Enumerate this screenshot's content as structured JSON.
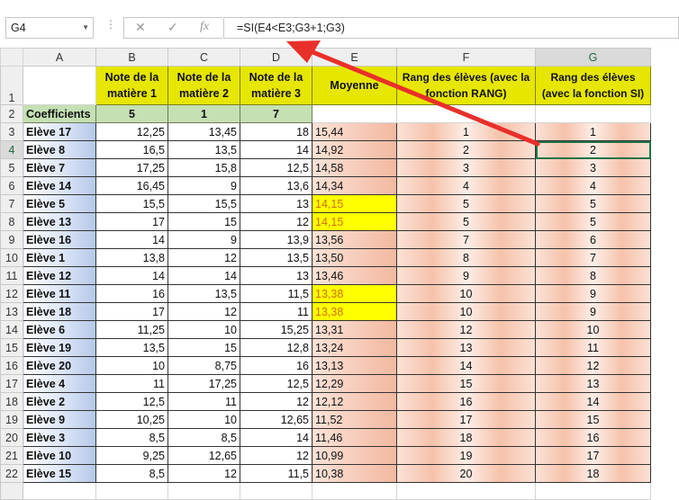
{
  "formula_bar": {
    "name_box": "G4",
    "cancel_icon": "✕",
    "enter_icon": "✓",
    "fx_label": "fx",
    "formula": "=SI(E4<E3;G3+1;G3)"
  },
  "columns": [
    "A",
    "B",
    "C",
    "D",
    "E",
    "F",
    "G"
  ],
  "header_row": {
    "row_num": "1",
    "b": "Note de la matière 1",
    "c": "Note de la matière 2",
    "d": "Note de la matière 3",
    "e": "Moyenne",
    "f": "Rang des élèves (avec la fonction RANG)",
    "g": "Rang des élèves (avec la fonction SI)"
  },
  "coef_row": {
    "row_num": "2",
    "a": "Coefficients",
    "b": "5",
    "c": "1",
    "d": "7"
  },
  "rows": [
    {
      "n": "3",
      "a": "Elève 17",
      "b": "12,25",
      "c": "13,45",
      "d": "18",
      "e": "15,44",
      "f": "1",
      "g": "1"
    },
    {
      "n": "4",
      "a": "Elève 8",
      "b": "16,5",
      "c": "13,5",
      "d": "14",
      "e": "14,92",
      "f": "2",
      "g": "2"
    },
    {
      "n": "5",
      "a": "Elève 7",
      "b": "17,25",
      "c": "15,8",
      "d": "12,5",
      "e": "14,58",
      "f": "3",
      "g": "3"
    },
    {
      "n": "6",
      "a": "Elève 14",
      "b": "16,45",
      "c": "9",
      "d": "13,6",
      "e": "14,34",
      "f": "4",
      "g": "4"
    },
    {
      "n": "7",
      "a": "Elève 5",
      "b": "15,5",
      "c": "15,5",
      "d": "13",
      "e": "14,15",
      "f": "5",
      "g": "5"
    },
    {
      "n": "8",
      "a": "Elève 13",
      "b": "17",
      "c": "15",
      "d": "12",
      "e": "14,15",
      "f": "5",
      "g": "5"
    },
    {
      "n": "9",
      "a": "Elève 16",
      "b": "14",
      "c": "9",
      "d": "13,9",
      "e": "13,56",
      "f": "7",
      "g": "6"
    },
    {
      "n": "10",
      "a": "Elève 1",
      "b": "13,8",
      "c": "12",
      "d": "13,5",
      "e": "13,50",
      "f": "8",
      "g": "7"
    },
    {
      "n": "11",
      "a": "Elève 12",
      "b": "14",
      "c": "14",
      "d": "13",
      "e": "13,46",
      "f": "9",
      "g": "8"
    },
    {
      "n": "12",
      "a": "Elève 11",
      "b": "16",
      "c": "13,5",
      "d": "11,5",
      "e": "13,38",
      "f": "10",
      "g": "9"
    },
    {
      "n": "13",
      "a": "Elève 18",
      "b": "17",
      "c": "12",
      "d": "11",
      "e": "13,38",
      "f": "10",
      "g": "9"
    },
    {
      "n": "14",
      "a": "Elève 6",
      "b": "11,25",
      "c": "10",
      "d": "15,25",
      "e": "13,31",
      "f": "12",
      "g": "10"
    },
    {
      "n": "15",
      "a": "Elève 19",
      "b": "13,5",
      "c": "15",
      "d": "12,8",
      "e": "13,24",
      "f": "13",
      "g": "11"
    },
    {
      "n": "16",
      "a": "Elève 20",
      "b": "10",
      "c": "8,75",
      "d": "16",
      "e": "13,13",
      "f": "14",
      "g": "12"
    },
    {
      "n": "17",
      "a": "Elève 4",
      "b": "11",
      "c": "17,25",
      "d": "12,5",
      "e": "12,29",
      "f": "15",
      "g": "13"
    },
    {
      "n": "18",
      "a": "Elève 2",
      "b": "12,5",
      "c": "11",
      "d": "12",
      "e": "12,12",
      "f": "16",
      "g": "14"
    },
    {
      "n": "19",
      "a": "Elève 9",
      "b": "10,25",
      "c": "10",
      "d": "12,65",
      "e": "11,52",
      "f": "17",
      "g": "15"
    },
    {
      "n": "20",
      "a": "Elève 3",
      "b": "8,5",
      "c": "8,5",
      "d": "14",
      "e": "11,46",
      "f": "18",
      "g": "16"
    },
    {
      "n": "21",
      "a": "Elève 10",
      "b": "9,25",
      "c": "12,65",
      "d": "12",
      "e": "10,99",
      "f": "19",
      "g": "17"
    },
    {
      "n": "22",
      "a": "Elève 15",
      "b": "8,5",
      "c": "12",
      "d": "11,5",
      "e": "10,38",
      "f": "20",
      "g": "18"
    }
  ],
  "highlight_rows": [
    "7",
    "8",
    "12",
    "13"
  ],
  "active_row": "4",
  "colors": {
    "header_yellow": "#e6e600",
    "coef_green": "#c5e0b3",
    "highlight_yellow": "#ffff00",
    "highlight_text": "#d07000",
    "arrow_red": "#e8302a",
    "selection_green": "#217346"
  }
}
